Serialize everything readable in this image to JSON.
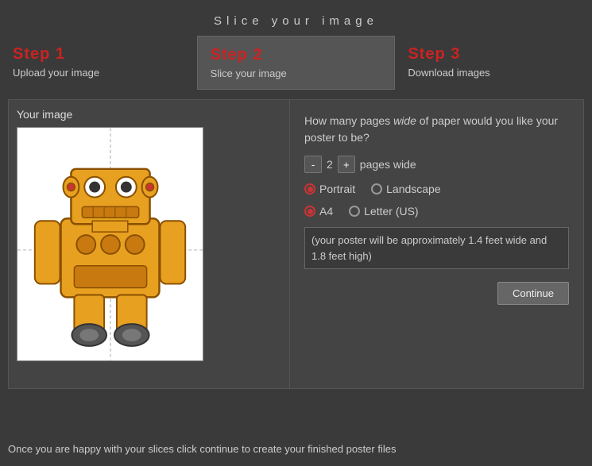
{
  "page": {
    "title": "Slice your image"
  },
  "steps": [
    {
      "id": "step1",
      "label": "Step 1",
      "desc": "Upload your image",
      "active": false
    },
    {
      "id": "step2",
      "label": "Step 2",
      "desc": "Slice your image",
      "active": true
    },
    {
      "id": "step3",
      "label": "Step 3",
      "desc": "Download images",
      "active": false
    }
  ],
  "left_panel": {
    "title": "Your image"
  },
  "right_panel": {
    "question": "How many pages wide of paper would you like your poster to be?",
    "pages_count": "2",
    "pages_label": "pages wide",
    "orientation_label_portrait": "Portrait",
    "orientation_label_landscape": "Landscape",
    "paper_size_a4": "A4",
    "paper_size_letter": "Letter (US)",
    "approx_text": "(your poster will be approximately 1.4 feet wide and 1.8 feet high)",
    "continue_label": "Continue"
  },
  "bottom": {
    "text": "Once you are happy with your slices click continue to create your finished poster files"
  }
}
